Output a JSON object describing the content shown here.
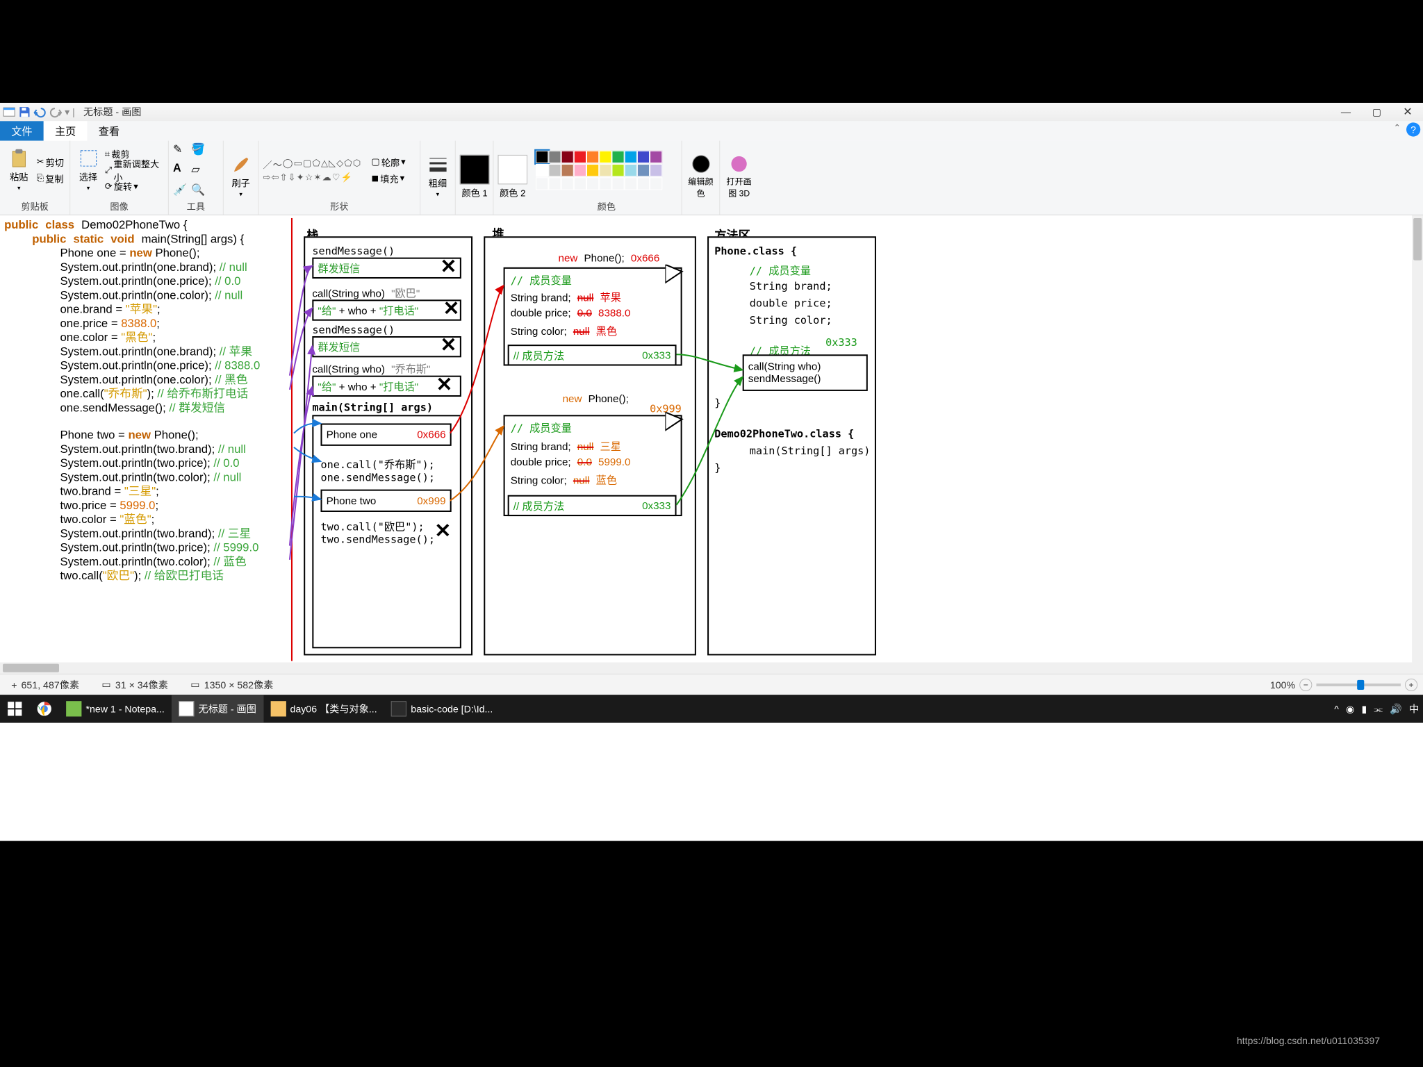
{
  "title": "无标题 - 画图",
  "tabs": {
    "file": "文件",
    "home": "主页",
    "view": "查看"
  },
  "ribbon": {
    "clipboard": {
      "label": "剪贴板",
      "paste": "粘贴",
      "cut": "剪切",
      "copy": "复制"
    },
    "image": {
      "label": "图像",
      "select": "选择",
      "crop": "裁剪",
      "resize": "重新调整大小",
      "rotate": "旋转"
    },
    "tools": {
      "label": "工具"
    },
    "brush": {
      "label": "刷子"
    },
    "shapes": {
      "label": "形状",
      "outline": "轮廓",
      "fill": "填充"
    },
    "thickness": {
      "label": "粗细"
    },
    "color1": {
      "label": "颜色 1"
    },
    "color2": {
      "label": "颜色 2"
    },
    "colors": {
      "label": "颜色"
    },
    "editcolors": {
      "label": "编辑颜色"
    },
    "paint3d": {
      "label": "打开画图 3D"
    }
  },
  "status": {
    "pos": "651, 487像素",
    "sel": "31 × 34像素",
    "size": "1350 × 582像素",
    "zoom": "100%"
  },
  "columns": {
    "stack": "栈",
    "heap": "堆",
    "methodarea": "方法区"
  },
  "stack_frames": {
    "f1": "sendMessage()",
    "f1b": "群发短信",
    "f2": "call(String who)",
    "f2arg": "\"欧巴\"",
    "f2body": "\"给\" + who + \"打电话\"",
    "f3": "sendMessage()",
    "f3b": "群发短信",
    "f4": "call(String who)",
    "f4arg": "\"乔布斯\"",
    "f4body": "\"给\" + who + \"打电话\"",
    "main": "main(String[] args)",
    "phone_one": "Phone one",
    "addr1": "0x666",
    "c1": "one.call(\"乔布斯\");",
    "c2": "one.sendMessage();",
    "phone_two": "Phone two",
    "addr2": "0x999",
    "c3": "two.call(\"欧巴\");",
    "c4": "two.sendMessage();"
  },
  "heap": {
    "new1": "new",
    "phone1": "Phone();",
    "addr1": "0x666",
    "memvar": "// 成员变量",
    "brand": "String brand;",
    "brand_null": "null",
    "brand_v1": "苹果",
    "price": "double price;",
    "price_null": "0.0",
    "price_v1": "8388.0",
    "color": "String color;",
    "color_null": "null",
    "color_v1": "黑色",
    "memmethod": "// 成员方法",
    "methods_addr": "0x333",
    "new2": "new",
    "phone2": "Phone();",
    "addr2": "0x999",
    "brand_v2": "三星",
    "price_v2": "5999.0",
    "color_v2": "蓝色"
  },
  "methodarea": {
    "phone_class": "Phone.class {",
    "memvar": "// 成员变量",
    "brand": "String brand;",
    "price": "double price;",
    "color": "String color;",
    "memmethod": "// 成员方法",
    "addr": "0x333",
    "call": "call(String who)",
    "send": "sendMessage()",
    "close": "}",
    "demo_class": "Demo02PhoneTwo.class {",
    "main": "main(String[] args)",
    "close2": "}"
  },
  "code": {
    "public": "public",
    "class": "class",
    "demo": "Demo02PhoneTwo {",
    "static": "static",
    "void": "void",
    "main": "main(String[] args) {",
    "phone": "Phone one = ",
    "new": "new",
    "phoneCtor": " Phone();",
    "l3": "System.out.println(one.brand); ",
    "c3": "// null",
    "l4": "System.out.println(one.price); ",
    "c4": "// 0.0",
    "l5": "System.out.println(one.color); ",
    "c5": "// null",
    "l6a": "one.brand = ",
    "l6b": "\"苹果\"",
    "l6c": ";",
    "l7a": "one.price = ",
    "l7b": "8388.0",
    "l7c": ";",
    "l8a": "one.color = ",
    "l8b": "\"黑色\"",
    "l8c": ";",
    "l9": "System.out.println(one.brand); ",
    "c9": "// 苹果",
    "l10": "System.out.println(one.price); ",
    "c10": "// 8388.0",
    "l11": "System.out.println(one.color); ",
    "c11": "// 黑色",
    "l12a": "one.call(",
    "l12b": "\"乔布斯\"",
    "l12c": "); ",
    "c12": "// 给乔布斯打电话",
    "l13": "one.sendMessage(); ",
    "c13": "// 群发短信",
    "phone2": "Phone two = ",
    "phone2Ctor": " Phone();",
    "l15": "System.out.println(two.brand); ",
    "c15": "// null",
    "l16": "System.out.println(two.price); ",
    "c16": "// 0.0",
    "l17": "System.out.println(two.color); ",
    "c17": "// null",
    "l18a": "two.brand = ",
    "l18b": "\"三星\"",
    "l18c": ";",
    "l19a": "two.price = ",
    "l19b": "5999.0",
    "l19c": ";",
    "l20a": "two.color = ",
    "l20b": "\"蓝色\"",
    "l20c": ";",
    "l21": "System.out.println(two.brand); ",
    "c21": "// 三星",
    "l22": "System.out.println(two.price); ",
    "c22": "// 5999.0",
    "l23": "System.out.println(two.color); ",
    "c23": "// 蓝色",
    "l24a": "two.call(",
    "l24b": "\"欧巴\"",
    "l24c": "); ",
    "c24": "// 给欧巴打电话"
  },
  "taskbar": {
    "t1": "*new 1 - Notepa...",
    "t2": "无标题 - 画图",
    "t3": "day06 【类与对象...",
    "t4": "basic-code [D:\\Id...",
    "ime": "中"
  },
  "watermark": "https://blog.csdn.net/u011035397"
}
